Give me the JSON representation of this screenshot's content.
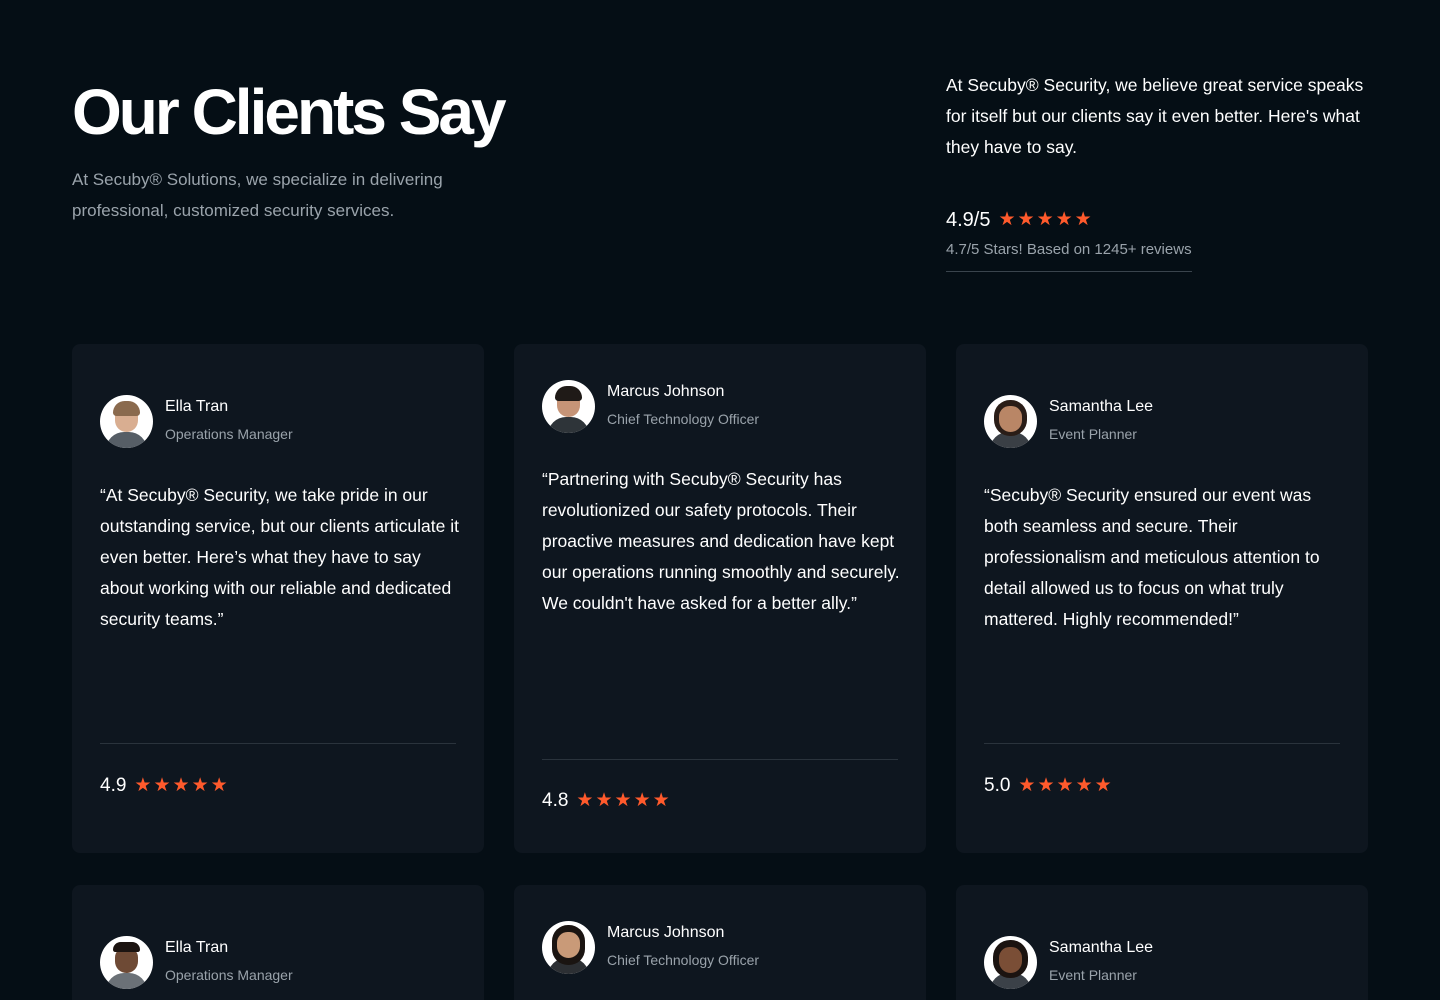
{
  "header": {
    "title": "Our Clients Say",
    "subtitle": "At Secuby® Solutions, we specialize in delivering professional, customized security services.",
    "intro": "At Secuby® Security, we believe great service speaks for itself but our clients say it even better. Here's what they have to say.",
    "overall_rating": "4.9/5",
    "overall_note": "4.7/5 Stars! Based on 1245+ reviews"
  },
  "colors": {
    "background": "#050e15",
    "card": "#0e161f",
    "star": "#ff5a2c",
    "muted_text": "#9aa3ab"
  },
  "testimonials": [
    {
      "name": "Ella Tran",
      "role": "Operations Manager",
      "quote": "“At Secuby® Security, we take pride in our outstanding service, but our clients articulate it even better. Here’s what they have to say about working with our reliable and dedicated security teams.”",
      "rating": "4.9",
      "avatar_icon": "man-portrait-icon"
    },
    {
      "name": "Marcus Johnson",
      "role": "Chief Technology Officer",
      "quote": "“Partnering with Secuby® Security has revolutionized our safety protocols. Their proactive measures and dedication have kept our operations running smoothly and securely. We couldn't have asked for a better ally.”",
      "rating": "4.8",
      "avatar_icon": "man-portrait-icon"
    },
    {
      "name": "Samantha Lee",
      "role": "Event Planner",
      "quote": "“Secuby® Security ensured our event was both seamless and secure. Their professionalism and meticulous attention to detail allowed us to focus on what truly mattered. Highly recommended!”",
      "rating": "5.0",
      "avatar_icon": "woman-portrait-icon"
    },
    {
      "name": "Ella Tran",
      "role": "Operations Manager",
      "avatar_icon": "man-portrait-icon"
    },
    {
      "name": "Marcus Johnson",
      "role": "Chief Technology Officer",
      "avatar_icon": "woman-portrait-icon"
    },
    {
      "name": "Samantha Lee",
      "role": "Event Planner",
      "avatar_icon": "woman-portrait-icon"
    }
  ]
}
